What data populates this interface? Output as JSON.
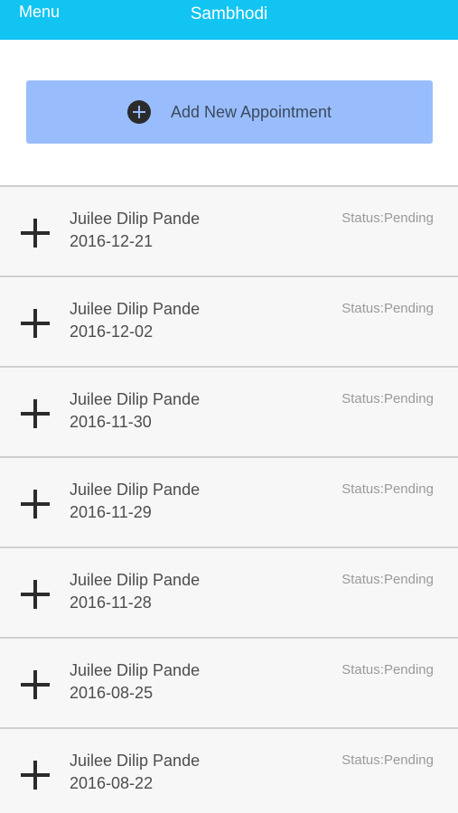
{
  "header": {
    "menu_label": "Menu",
    "title": "Sambhodi",
    "background_color": "#12c4f1"
  },
  "add_button": {
    "label": "Add New Appointment",
    "icon": "plus-circle-icon",
    "background_color": "#99bdfc"
  },
  "appointments": [
    {
      "name": "Juilee Dilip Pande",
      "date": "2016-12-21",
      "status": "Status:Pending"
    },
    {
      "name": "Juilee Dilip Pande",
      "date": "2016-12-02",
      "status": "Status:Pending"
    },
    {
      "name": "Juilee Dilip Pande",
      "date": "2016-11-30",
      "status": "Status:Pending"
    },
    {
      "name": "Juilee Dilip Pande",
      "date": "2016-11-29",
      "status": "Status:Pending"
    },
    {
      "name": "Juilee Dilip Pande",
      "date": "2016-11-28",
      "status": "Status:Pending"
    },
    {
      "name": "Juilee Dilip Pande",
      "date": "2016-08-25",
      "status": "Status:Pending"
    },
    {
      "name": "Juilee Dilip Pande",
      "date": "2016-08-22",
      "status": "Status:Pending"
    }
  ]
}
